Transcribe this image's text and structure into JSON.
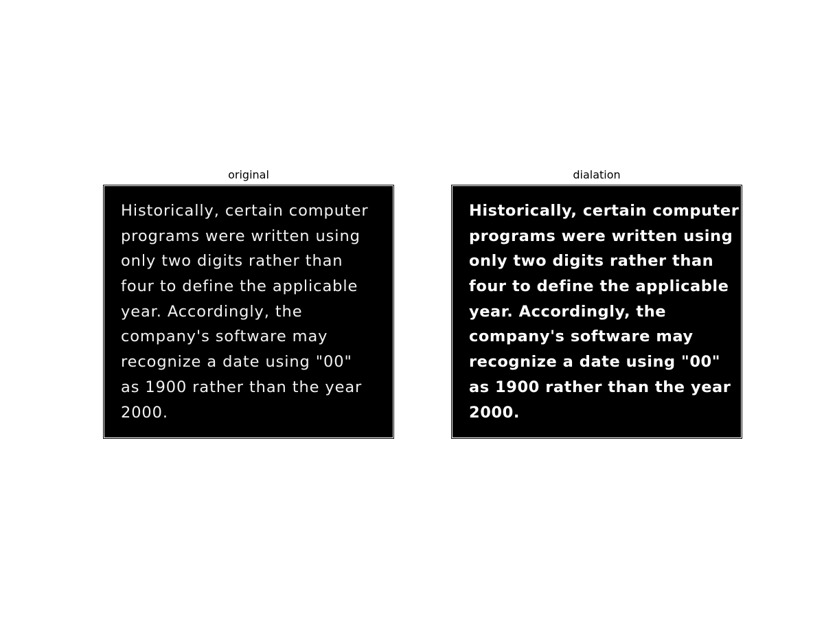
{
  "panels": [
    {
      "title": "original",
      "lines": [
        "Historically, certain computer",
        "programs were written using",
        "only two digits rather than",
        "four to define the applicable",
        "year. Accordingly, the",
        "company's software may",
        "recognize a date using \"00\"",
        "as 1900 rather than the year",
        "2000."
      ]
    },
    {
      "title": "dialation",
      "lines": [
        "Historically, certain computer",
        "programs were written using",
        "only two digits rather than",
        "four to define the applicable",
        "year. Accordingly, the",
        "company's software may",
        "recognize a date using \"00\"",
        "as 1900 rather than the year",
        "2000."
      ]
    }
  ]
}
